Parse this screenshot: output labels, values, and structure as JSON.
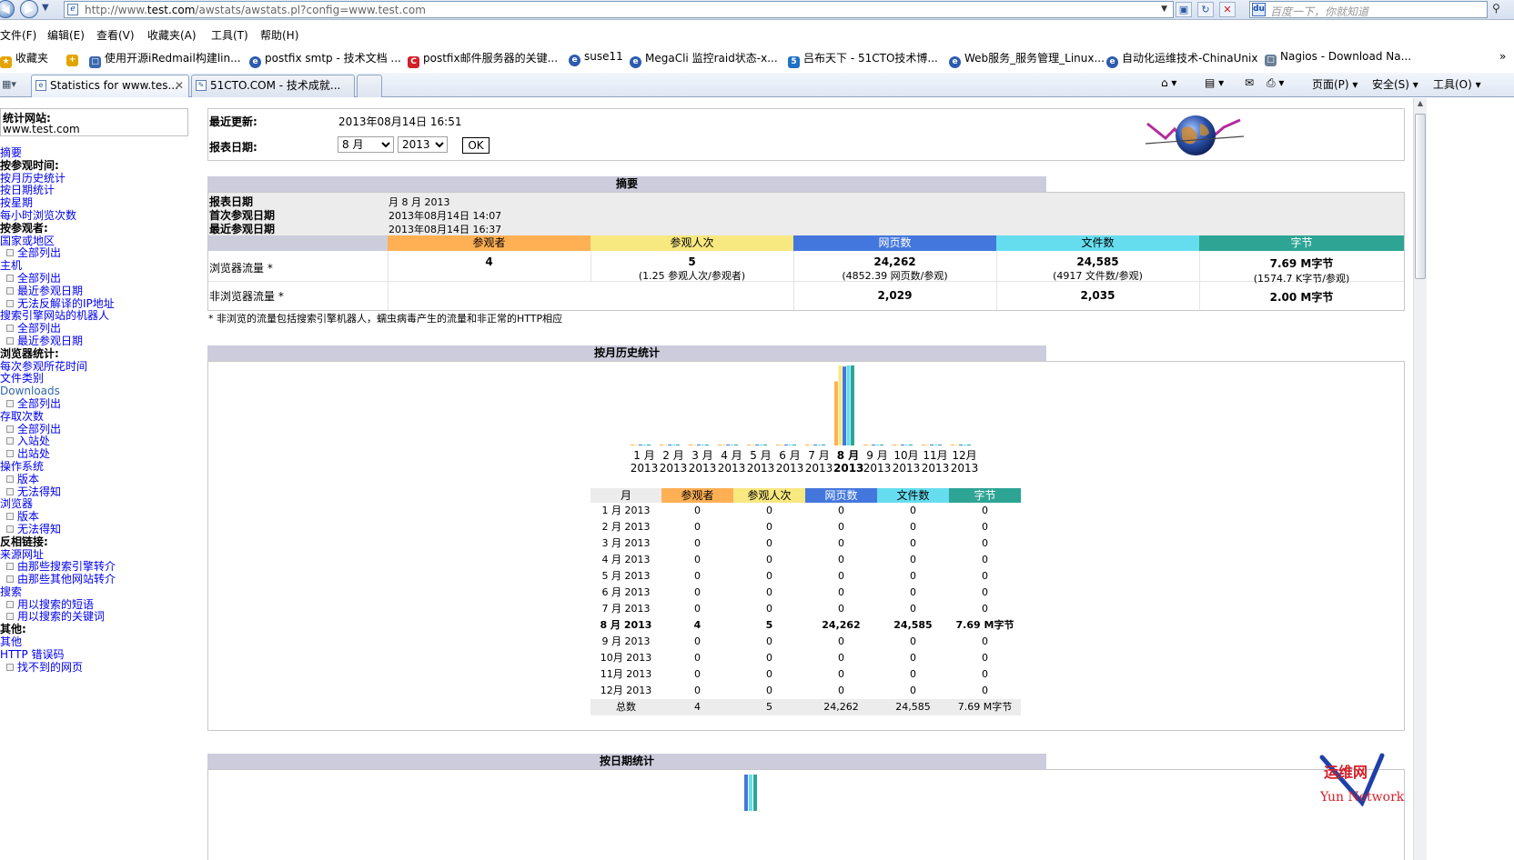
{
  "browser": {
    "url_prefix": "http://www.",
    "url_host": "test.com",
    "url_rest": "/awstats/awstats.pl?config=www.test.com",
    "search_placeholder": "百度一下，你就知道",
    "menu": [
      "文件(F)",
      "编辑(E)",
      "查看(V)",
      "收藏夹(A)",
      "工具(T)",
      "帮助(H)"
    ],
    "favorites": [
      {
        "label": "收藏夹",
        "color": "#e4a400"
      },
      {
        "label": "使用开源iRedmail构建lin...",
        "color": "#3c67b1"
      },
      {
        "label": "postfix smtp - 技术文档 ...",
        "color": "#2c5bb0"
      },
      {
        "label": "postfix邮件服务器的关键...",
        "color": "#d2202a"
      },
      {
        "label": "suse11",
        "color": "#2c5bb0"
      },
      {
        "label": "MegaCli 监控raid状态-x...",
        "color": "#2c5bb0"
      },
      {
        "label": "吕布天下 - 51CTO技术博...",
        "color": "#1e73c4"
      },
      {
        "label": "Web服务_服务管理_Linux...",
        "color": "#2c5bb0"
      },
      {
        "label": "自动化运维技术-ChinaUnix",
        "color": "#2c5bb0"
      },
      {
        "label": "Nagios - Download Na...",
        "color": "#6a7f98"
      }
    ],
    "tabs": [
      {
        "label": "Statistics for www.tes..."
      },
      {
        "label": "51CTO.COM - 技术成就..."
      }
    ],
    "commands": [
      "页面(P)",
      "安全(S)",
      "工具(O)"
    ]
  },
  "sidebar": {
    "site_label": "统计网站:",
    "site_value": "www.test.com",
    "items": [
      {
        "t": "摘要",
        "k": "a"
      },
      {
        "t": "按参观时间:",
        "k": "h"
      },
      {
        "t": "按月历史统计",
        "k": "a"
      },
      {
        "t": "按日期统计",
        "k": "a"
      },
      {
        "t": "按星期",
        "k": "a"
      },
      {
        "t": "每小时浏览次数",
        "k": "a"
      },
      {
        "t": "按参观者:",
        "k": "h"
      },
      {
        "t": "国家或地区",
        "k": "a"
      },
      {
        "t": "全部列出",
        "k": "sub"
      },
      {
        "t": "主机",
        "k": "a"
      },
      {
        "t": "全部列出",
        "k": "sub"
      },
      {
        "t": "最近参观日期",
        "k": "sub"
      },
      {
        "t": "无法反解译的IP地址",
        "k": "sub"
      },
      {
        "t": "搜索引擎网站的机器人",
        "k": "a"
      },
      {
        "t": "全部列出",
        "k": "sub"
      },
      {
        "t": "最近参观日期",
        "k": "sub"
      },
      {
        "t": "浏览器统计:",
        "k": "h"
      },
      {
        "t": "每次参观所花时间",
        "k": "a"
      },
      {
        "t": "文件类别",
        "k": "a"
      },
      {
        "t": "Downloads",
        "k": "dl"
      },
      {
        "t": "全部列出",
        "k": "sub"
      },
      {
        "t": "存取次数",
        "k": "a"
      },
      {
        "t": "全部列出",
        "k": "sub"
      },
      {
        "t": "入站处",
        "k": "sub"
      },
      {
        "t": "出站处",
        "k": "sub"
      },
      {
        "t": "操作系统",
        "k": "a"
      },
      {
        "t": "版本",
        "k": "sub"
      },
      {
        "t": "无法得知",
        "k": "sub"
      },
      {
        "t": "浏览器",
        "k": "a"
      },
      {
        "t": "版本",
        "k": "sub"
      },
      {
        "t": "无法得知",
        "k": "sub"
      },
      {
        "t": "反相链接:",
        "k": "h"
      },
      {
        "t": "来源网址",
        "k": "a"
      },
      {
        "t": "由那些搜索引擎转介",
        "k": "sub"
      },
      {
        "t": "由那些其他网站转介",
        "k": "sub"
      },
      {
        "t": "搜索",
        "k": "a"
      },
      {
        "t": "用以搜索的短语",
        "k": "sub"
      },
      {
        "t": "用以搜索的关键词",
        "k": "sub"
      },
      {
        "t": "其他:",
        "k": "h"
      },
      {
        "t": "其他",
        "k": "a"
      },
      {
        "t": "HTTP 错误码",
        "k": "a"
      },
      {
        "t": "找不到的网页",
        "k": "sub"
      }
    ]
  },
  "header": {
    "last_update_label": "最近更新:",
    "last_update_value": "2013年08月14日 16:51",
    "report_date_label": "报表日期:",
    "month_select": "8 月",
    "year_select": "2013",
    "ok_label": "OK"
  },
  "summary": {
    "title": "摘要",
    "rows": [
      {
        "label": "报表日期",
        "value": "月 8 月 2013"
      },
      {
        "label": "首次参观日期",
        "value": "2013年08月14日 14:07"
      },
      {
        "label": "最近参观日期",
        "value": "2013年08月14日 16:37"
      }
    ],
    "columns": [
      {
        "label": "参观者",
        "color": "#ffb055"
      },
      {
        "label": "参观人次",
        "color": "#f8e880"
      },
      {
        "label": "网页数",
        "color": "#4477dd"
      },
      {
        "label": "文件数",
        "color": "#66ddee"
      },
      {
        "label": "字节",
        "color": "#2ea495"
      }
    ],
    "browser_label": "浏览器流量 *",
    "browser_values": [
      {
        "main": "4",
        "sub": ""
      },
      {
        "main": "5",
        "sub": "(1.25 参观人次/参观者)"
      },
      {
        "main": "24,262",
        "sub": "(4852.39 网页数/参观)"
      },
      {
        "main": "24,585",
        "sub": "(4917 文件数/参观)"
      },
      {
        "main": "7.69 M字节",
        "sub": "(1574.7 K字节/参观)"
      }
    ],
    "nonbrowser_label": "非浏览器流量 *",
    "nonbrowser_values": [
      "2,029",
      "2,035",
      "2.00 M字节"
    ],
    "footnote": "* 非浏览的流量包括搜索引擎机器人，蠕虫病毒产生的流量和非正常的HTTP相应"
  },
  "monthly": {
    "title": "按月历史统计",
    "headers": [
      "月",
      "参观者",
      "参观人次",
      "网页数",
      "文件数",
      "字节"
    ],
    "rows": [
      [
        "1 月 2013",
        "0",
        "0",
        "0",
        "0",
        "0"
      ],
      [
        "2 月 2013",
        "0",
        "0",
        "0",
        "0",
        "0"
      ],
      [
        "3 月 2013",
        "0",
        "0",
        "0",
        "0",
        "0"
      ],
      [
        "4 月 2013",
        "0",
        "0",
        "0",
        "0",
        "0"
      ],
      [
        "5 月 2013",
        "0",
        "0",
        "0",
        "0",
        "0"
      ],
      [
        "6 月 2013",
        "0",
        "0",
        "0",
        "0",
        "0"
      ],
      [
        "7 月 2013",
        "0",
        "0",
        "0",
        "0",
        "0"
      ],
      [
        "8 月 2013",
        "4",
        "5",
        "24,262",
        "24,585",
        "7.69 M字节"
      ],
      [
        "9 月 2013",
        "0",
        "0",
        "0",
        "0",
        "0"
      ],
      [
        "10月 2013",
        "0",
        "0",
        "0",
        "0",
        "0"
      ],
      [
        "11月 2013",
        "0",
        "0",
        "0",
        "0",
        "0"
      ],
      [
        "12月 2013",
        "0",
        "0",
        "0",
        "0",
        "0"
      ]
    ],
    "total": [
      "总数",
      "4",
      "5",
      "24,262",
      "24,585",
      "7.69 M字节"
    ],
    "axis_months": [
      "1 月",
      "2 月",
      "3 月",
      "4 月",
      "5 月",
      "6 月",
      "7 月",
      "8 月",
      "9 月",
      "10月",
      "11月",
      "12月"
    ],
    "axis_year": "2013",
    "current_index": 7
  },
  "chart_data": {
    "type": "bar",
    "categories": [
      "1 月 2013",
      "2 月 2013",
      "3 月 2013",
      "4 月 2013",
      "5 月 2013",
      "6 月 2013",
      "7 月 2013",
      "8 月 2013",
      "9 月 2013",
      "10月 2013",
      "11月 2013",
      "12月 2013"
    ],
    "series": [
      {
        "name": "参观者",
        "color": "#ffb055",
        "values": [
          0,
          0,
          0,
          0,
          0,
          0,
          0,
          4,
          0,
          0,
          0,
          0
        ]
      },
      {
        "name": "参观人次",
        "color": "#f8e880",
        "values": [
          0,
          0,
          0,
          0,
          0,
          0,
          0,
          5,
          0,
          0,
          0,
          0
        ]
      },
      {
        "name": "网页数",
        "color": "#4477dd",
        "values": [
          0,
          0,
          0,
          0,
          0,
          0,
          0,
          24262,
          0,
          0,
          0,
          0
        ]
      },
      {
        "name": "文件数",
        "color": "#66ddee",
        "values": [
          0,
          0,
          0,
          0,
          0,
          0,
          0,
          24585,
          0,
          0,
          0,
          0
        ]
      },
      {
        "name": "字节",
        "color": "#2ea495",
        "values": [
          0,
          0,
          0,
          0,
          0,
          0,
          0,
          7.69,
          0,
          0,
          0,
          0
        ]
      }
    ]
  },
  "daily": {
    "title": "按日期统计"
  },
  "watermark": {
    "line1": "运维网",
    "line2": "Yun Network"
  }
}
